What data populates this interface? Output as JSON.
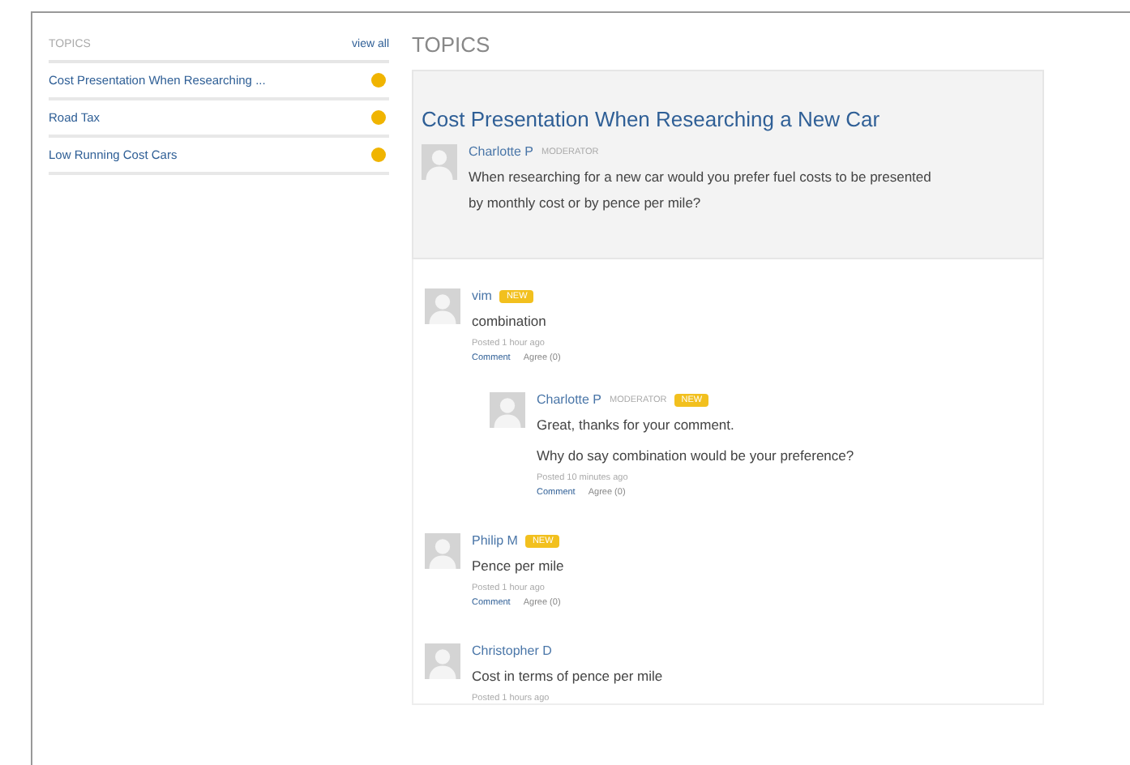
{
  "sidebar": {
    "title": "TOPICS",
    "view_all": "view all",
    "items": [
      {
        "label": "Cost Presentation When Researching ...",
        "selected": false
      },
      {
        "label": "Road Tax",
        "selected": false
      },
      {
        "label": "Low Running Cost Cars",
        "selected": false
      }
    ]
  },
  "main": {
    "heading": "TOPICS",
    "topic": {
      "title": "Cost Presentation When Researching a New Car",
      "author": "Charlotte P",
      "role": "MODERATOR",
      "text": "When researching for a new car would you prefer fuel costs to be presented by monthly cost or by pence per mile?"
    },
    "comments": [
      {
        "author": "vim",
        "badge": "NEW",
        "lines": [
          "combination"
        ],
        "posted": "Posted 1 hour ago",
        "comment": "Comment",
        "agree": "Agree (0)",
        "children": [
          {
            "author": "Charlotte P",
            "role": "MODERATOR",
            "badge": "NEW",
            "lines": [
              "Great, thanks for your comment.",
              "Why do say combination would be your preference?"
            ],
            "posted": "Posted 10 minutes ago",
            "comment": "Comment",
            "agree": "Agree (0)"
          }
        ]
      },
      {
        "author": "Philip M",
        "badge": "NEW",
        "lines": [
          "Pence per mile"
        ],
        "posted": "Posted 1 hour ago",
        "comment": "Comment",
        "agree": "Agree (0)"
      },
      {
        "author": "Christopher D",
        "lines": [
          "Cost in terms of pence per mile"
        ],
        "posted": "Posted 1 hours ago"
      }
    ]
  }
}
